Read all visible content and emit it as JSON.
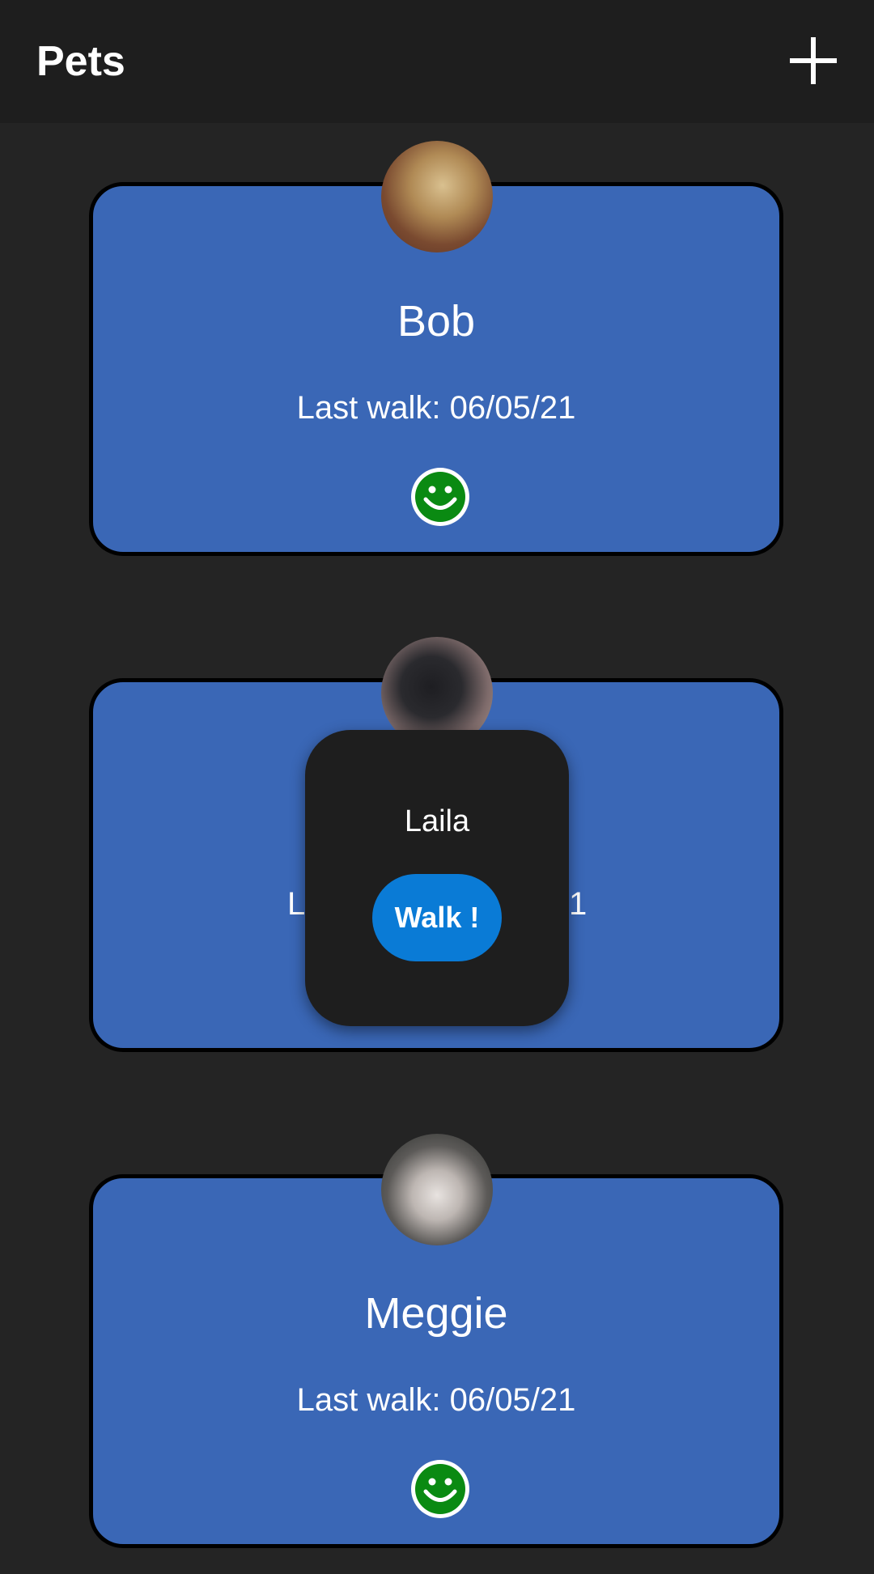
{
  "app_bar": {
    "title": "Pets",
    "add_icon": "plus-icon"
  },
  "pets": [
    {
      "name": "Bob",
      "last_walk": "Last walk: 06/05/21",
      "mood_icon": "smiley-face-icon",
      "avatar": "dog-photo"
    },
    {
      "name": "Laila",
      "last_walk_visible_left": "L",
      "last_walk_visible_right": "1",
      "avatar": "black-dog-photo"
    },
    {
      "name": "Meggie",
      "last_walk": "Last walk: 06/05/21",
      "mood_icon": "smiley-face-icon",
      "avatar": "cat-photo"
    }
  ],
  "popup": {
    "pet_name": "Laila",
    "walk_button_label": "Walk !"
  },
  "colors": {
    "background": "#242424",
    "app_bar": "#1e1e1e",
    "card": "#3a67b6",
    "button": "#0a7bd6",
    "mood_green": "#0a8a12"
  }
}
